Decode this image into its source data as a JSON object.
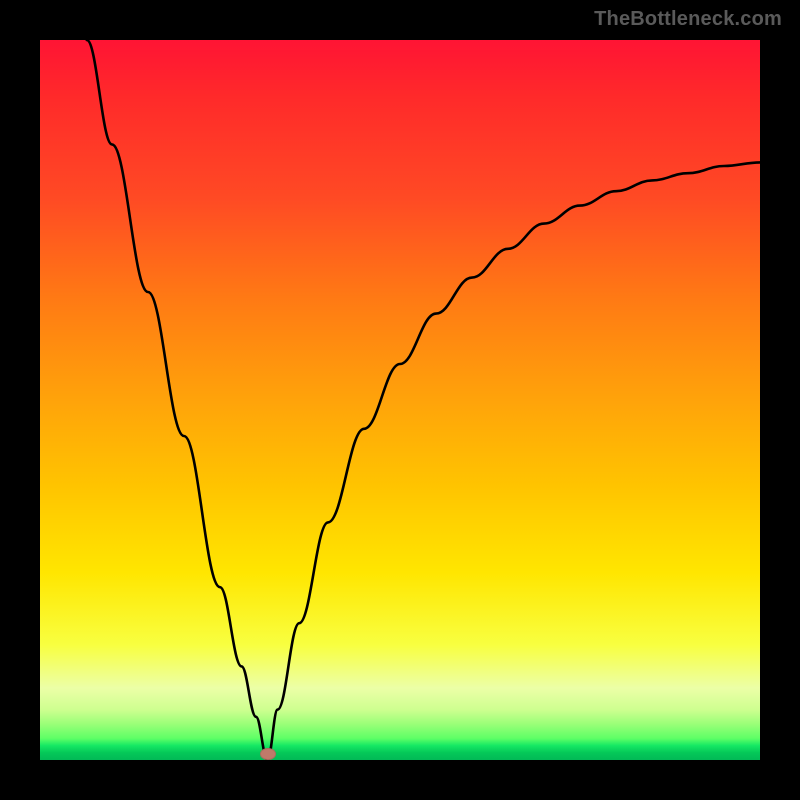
{
  "watermark": {
    "text": "TheBottleneck.com"
  },
  "marker": {
    "x_frac": 0.316,
    "y_frac": 0.992,
    "color": "#bf7a6a"
  },
  "chart_data": {
    "type": "line",
    "title": "",
    "xlabel": "",
    "ylabel": "",
    "xlim": [
      0,
      1
    ],
    "ylim": [
      0,
      1
    ],
    "grid": false,
    "legend": false,
    "annotations": [
      "TheBottleneck.com"
    ],
    "notes": "V-shaped bottleneck curve over a red→green vertical heatmap. No tick labels or axis text are visible; x and y are normalized to the plot area. Values are read off the rendered shape; minimum (best match) near x≈0.316 at y≈0.",
    "series": [
      {
        "name": "bottleneck-curve",
        "x": [
          0.065,
          0.1,
          0.15,
          0.2,
          0.25,
          0.28,
          0.3,
          0.316,
          0.33,
          0.36,
          0.4,
          0.45,
          0.5,
          0.55,
          0.6,
          0.65,
          0.7,
          0.75,
          0.8,
          0.85,
          0.9,
          0.95,
          1.0
        ],
        "values": [
          1.0,
          0.855,
          0.65,
          0.45,
          0.24,
          0.13,
          0.06,
          0.0,
          0.07,
          0.19,
          0.33,
          0.46,
          0.55,
          0.62,
          0.67,
          0.71,
          0.745,
          0.77,
          0.79,
          0.805,
          0.815,
          0.825,
          0.83
        ]
      }
    ],
    "marker": {
      "x": 0.316,
      "y": 0.0
    },
    "background_gradient": {
      "direction": "vertical",
      "stops": [
        {
          "pos": 0.0,
          "color": "#ff1434"
        },
        {
          "pos": 0.5,
          "color": "#ffa30a"
        },
        {
          "pos": 0.74,
          "color": "#ffe600"
        },
        {
          "pos": 0.93,
          "color": "#ceff90"
        },
        {
          "pos": 1.0,
          "color": "#02b956"
        }
      ]
    }
  }
}
